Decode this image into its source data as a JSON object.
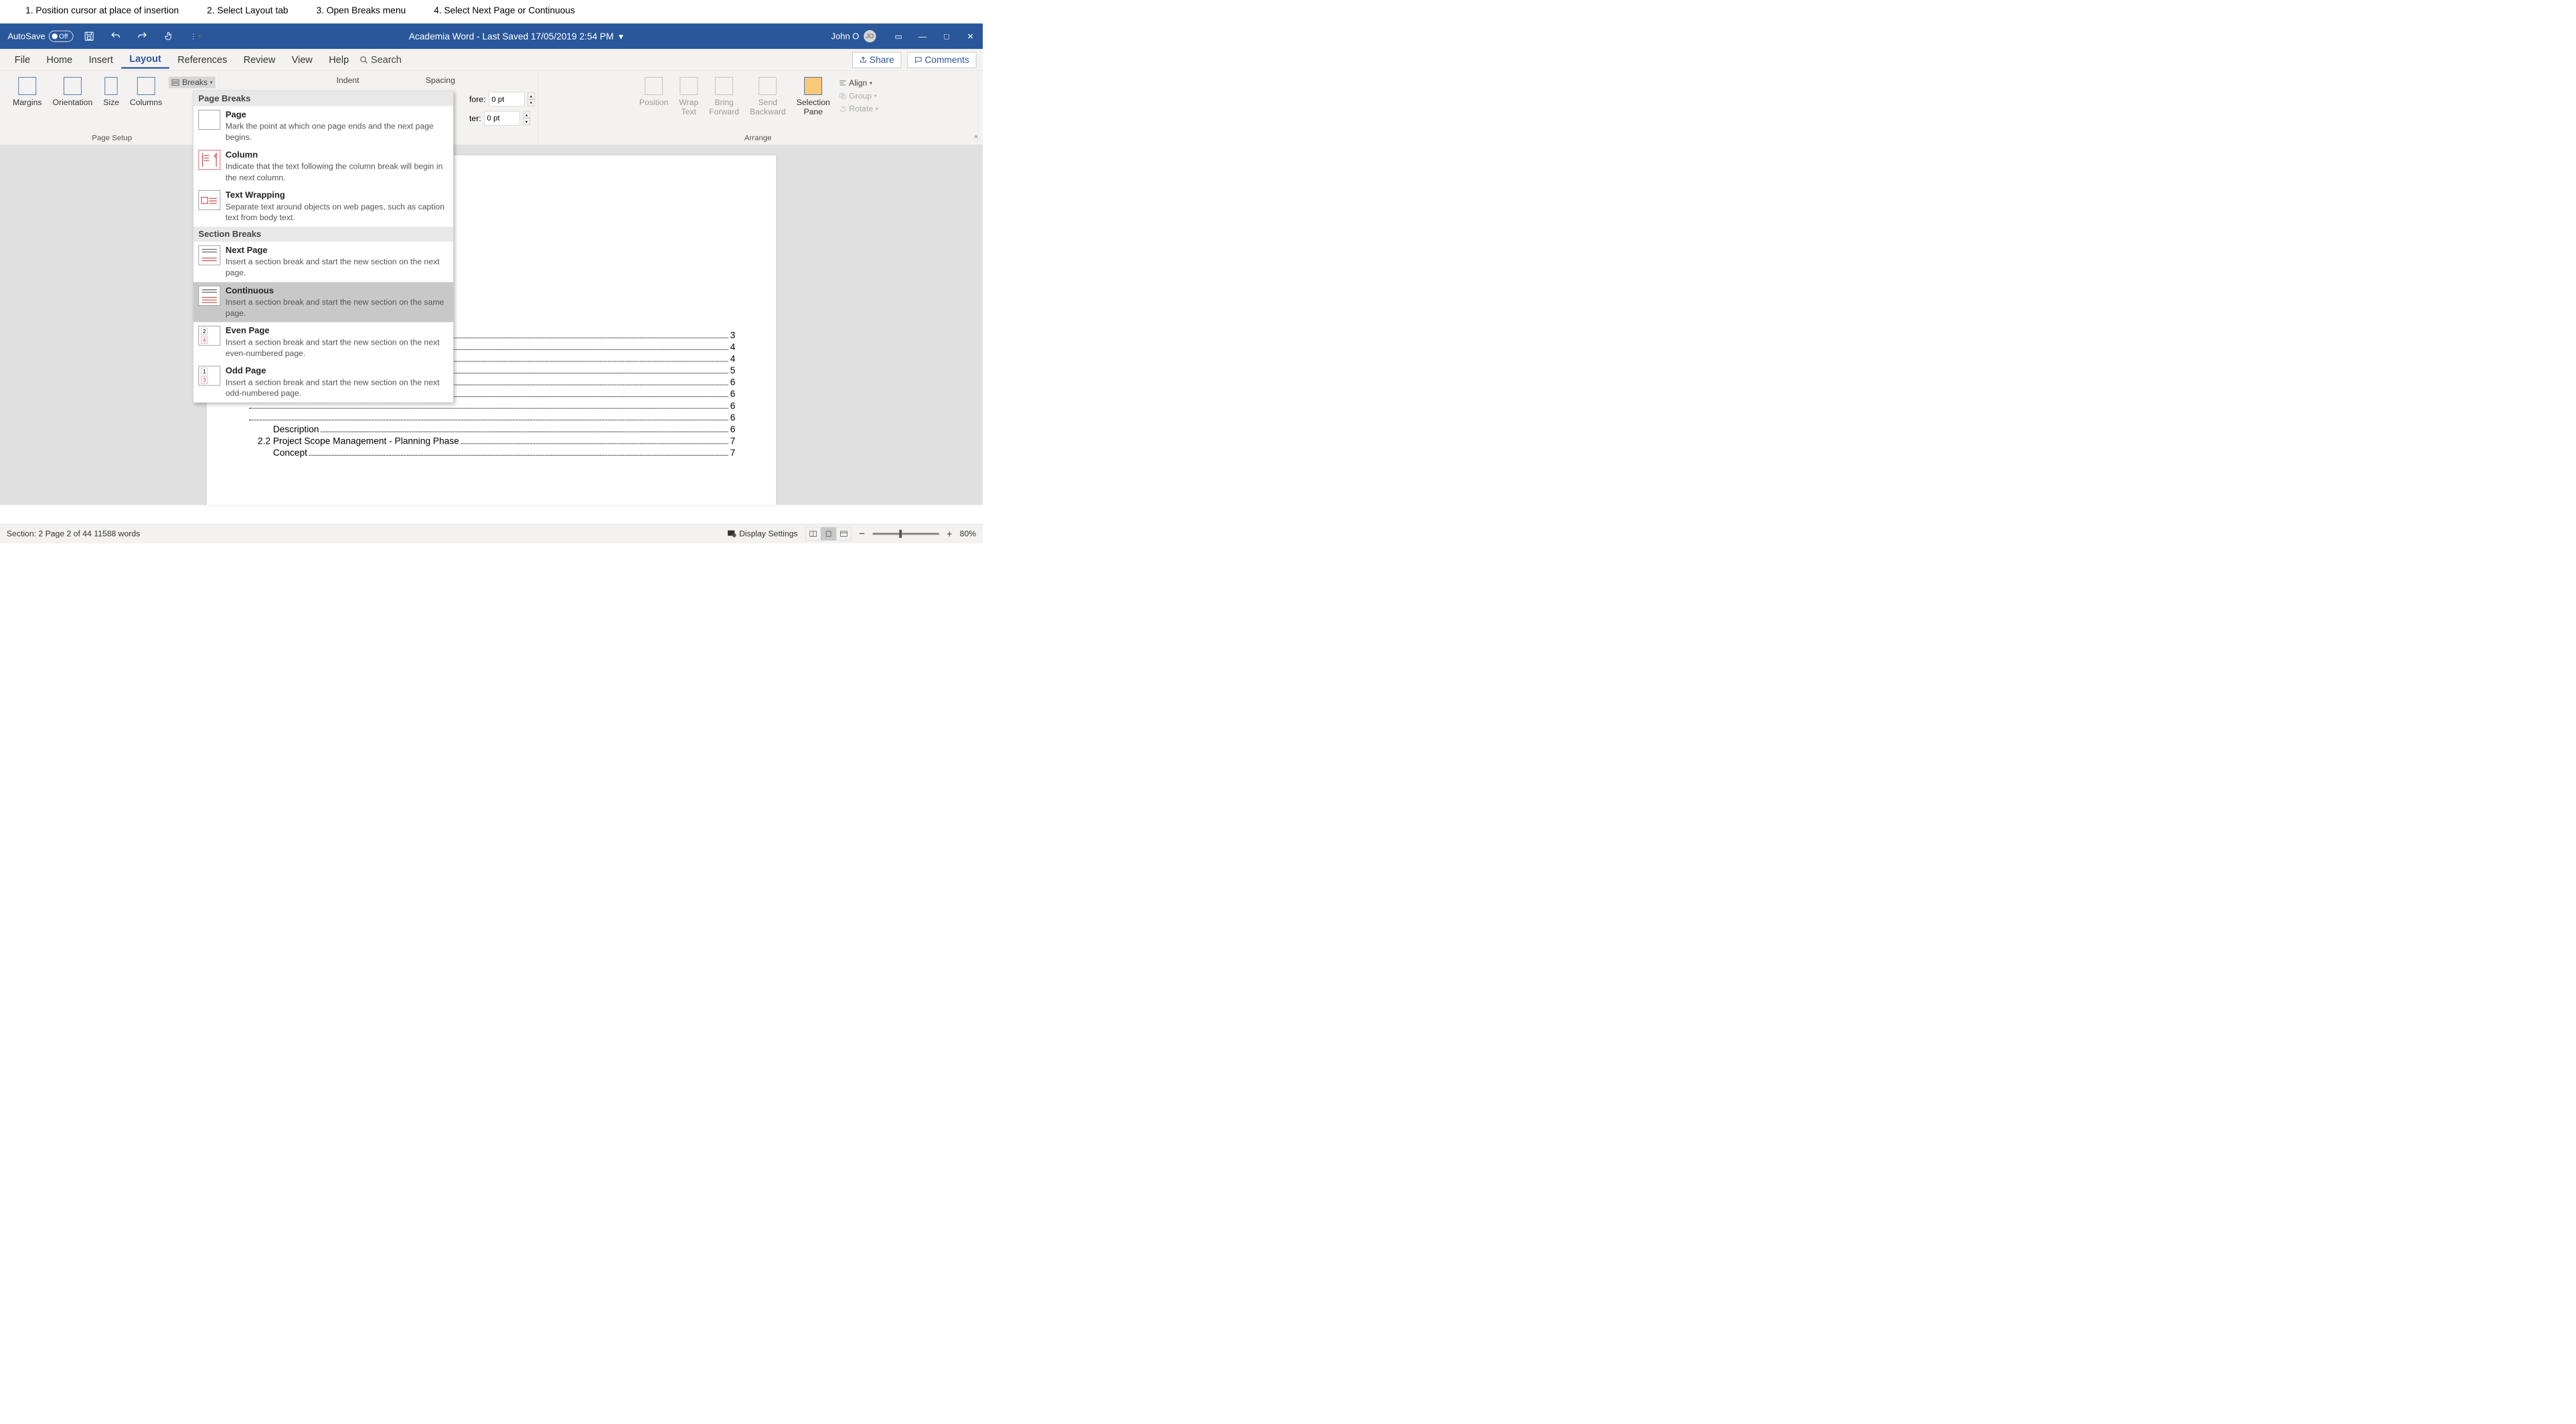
{
  "instructions": {
    "s1": "1. Position cursor at place of insertion",
    "s2": "2. Select Layout tab",
    "s3": "3. Open Breaks menu",
    "s4": "4. Select Next Page or Continuous"
  },
  "titlebar": {
    "autosave": "AutoSave",
    "toggle": "Off",
    "title": "Academia Word  -  Last Saved 17/05/2019 2:54 PM",
    "user": "John O",
    "initials": "JO"
  },
  "tabs": {
    "file": "File",
    "home": "Home",
    "insert": "Insert",
    "layout": "Layout",
    "references": "References",
    "review": "Review",
    "view": "View",
    "help": "Help",
    "search": "Search",
    "share": "Share",
    "comments": "Comments"
  },
  "ribbon": {
    "margins": "Margins",
    "orientation": "Orientation",
    "size": "Size",
    "columns": "Columns",
    "breaks": "Breaks",
    "pagesetup": "Page Setup",
    "indent": "Indent",
    "spacing": "Spacing",
    "before_l": "fore:",
    "before_v": "0 pt",
    "after_l": "ter:",
    "after_v": "0 pt",
    "position": "Position",
    "wrap1": "Wrap",
    "wrap2": "Text",
    "bring1": "Bring",
    "bring2": "Forward",
    "send1": "Send",
    "send2": "Backward",
    "sel1": "Selection",
    "sel2": "Pane",
    "align": "Align",
    "group": "Group",
    "rotate": "Rotate",
    "arrange": "Arrange"
  },
  "breaksmenu": {
    "pagehead": "Page Breaks",
    "page_t": "Page",
    "page_d": "Mark the point at which one page ends and the next page begins.",
    "col_t": "Column",
    "col_d": "Indicate that the text following the column break will begin in the next column.",
    "tw_t": "Text Wrapping",
    "tw_d": "Separate text around objects on web pages, such as caption text from body text.",
    "sechead": "Section Breaks",
    "np_t": "Next Page",
    "np_d": "Insert a section break and start the new section on the next page.",
    "cont_t": "Continuous",
    "cont_d": "Insert a section break and start the new section on the same page.",
    "ep_t": "Even Page",
    "ep_d": "Insert a section break and start the new section on the next even-numbered page.",
    "op_t": "Odd Page",
    "op_d": "Insert a section break and start the new section on the next odd-numbered page."
  },
  "toc": {
    "l1": {
      "t": "",
      "p": "3"
    },
    "l2": {
      "t": "",
      "p": "4"
    },
    "l3": {
      "t": "",
      "p": "4"
    },
    "l4": {
      "t": "",
      "p": "5"
    },
    "l5": {
      "t": "",
      "p": "6"
    },
    "l6": {
      "t": "",
      "p": "6"
    },
    "l7": {
      "t": "",
      "p": "6"
    },
    "l8": {
      "t": "",
      "p": "6"
    },
    "l9": {
      "t": "Description",
      "p": "6"
    },
    "l10": {
      "t": "2.2 Project Scope Management - Planning Phase",
      "p": "7"
    },
    "l11": {
      "t": "Concept",
      "p": "7"
    }
  },
  "status": {
    "left": "Section: 2   Page 2 of 44   11588 words",
    "display": "Display Settings",
    "zoom": "80%"
  }
}
